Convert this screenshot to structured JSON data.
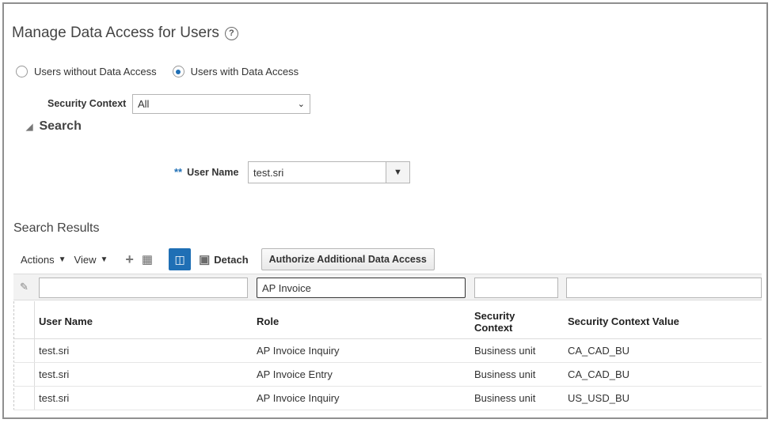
{
  "page": {
    "title": "Manage Data Access for Users",
    "help_icon": "?"
  },
  "access_filter": {
    "options": [
      {
        "label": "Users without Data Access",
        "selected": false
      },
      {
        "label": "Users with Data Access",
        "selected": true
      }
    ]
  },
  "security_context": {
    "label": "Security Context",
    "value": "All"
  },
  "search": {
    "header": "Search",
    "required_marker": "**",
    "user_name_label": "User Name",
    "user_name_value": "test.sri"
  },
  "results": {
    "title": "Search Results",
    "toolbar": {
      "actions_label": "Actions",
      "view_label": "View",
      "detach_label": "Detach",
      "authorize_label": "Authorize Additional Data Access"
    },
    "filters": {
      "user_name": "",
      "role": "AP Invoice",
      "security_context": "",
      "security_context_value": ""
    },
    "columns": {
      "user_name": "User Name",
      "role": "Role",
      "security_context": "Security Context",
      "security_context_value": "Security Context Value"
    },
    "rows": [
      {
        "user_name": "test.sri",
        "role": "AP Invoice Inquiry",
        "security_context": "Business unit",
        "security_context_value": "CA_CAD_BU"
      },
      {
        "user_name": "test.sri",
        "role": "AP Invoice Entry",
        "security_context": "Business unit",
        "security_context_value": "CA_CAD_BU"
      },
      {
        "user_name": "test.sri",
        "role": "AP Invoice Inquiry",
        "security_context": "Business unit",
        "security_context_value": "US_USD_BU"
      }
    ]
  }
}
